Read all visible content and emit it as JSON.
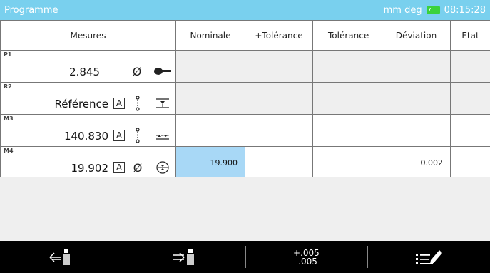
{
  "titlebar": {
    "title": "Programme",
    "units": "mm deg",
    "time": "08:15:28",
    "battery_icon": "battery-charged-icon"
  },
  "table": {
    "headers": [
      "Mesures",
      "Nominale",
      "+Tolérance",
      "-Tolérance",
      "Déviation",
      "Etat"
    ],
    "rows": [
      {
        "label": "P1",
        "value": "2.845",
        "nominal": "",
        "plus_tol": "",
        "minus_tol": "",
        "deviation": "",
        "state": "",
        "icons": [
          "diameter-icon",
          "probe-icon"
        ]
      },
      {
        "label": "R2",
        "value": "Référence",
        "nominal": "",
        "plus_tol": "",
        "minus_tol": "",
        "deviation": "",
        "state": "",
        "icons": [
          "a-reference-icon",
          "dotted-axis-icon",
          "horizontal-reference-icon"
        ]
      },
      {
        "label": "M3",
        "value": "140.830",
        "nominal": "",
        "plus_tol": "",
        "minus_tol": "",
        "deviation": "",
        "state": "",
        "icons": [
          "a-reference-icon",
          "dotted-axis-icon",
          "distance-icon"
        ]
      },
      {
        "label": "M4",
        "value": "19.902",
        "nominal": "19.900",
        "plus_tol": "",
        "minus_tol": "",
        "deviation": "0.002",
        "state": "",
        "icons": [
          "a-reference-icon",
          "diameter-icon",
          "circle-probe-icon"
        ]
      }
    ]
  },
  "a_symbol": "A",
  "diameter_symbol": "Ø",
  "bottombar": {
    "tolerance_plus": "+.005",
    "tolerance_minus": "-.005",
    "buttons": [
      "import-usb-icon",
      "export-usb-icon",
      "tolerance-button",
      "edit-list-icon"
    ]
  }
}
